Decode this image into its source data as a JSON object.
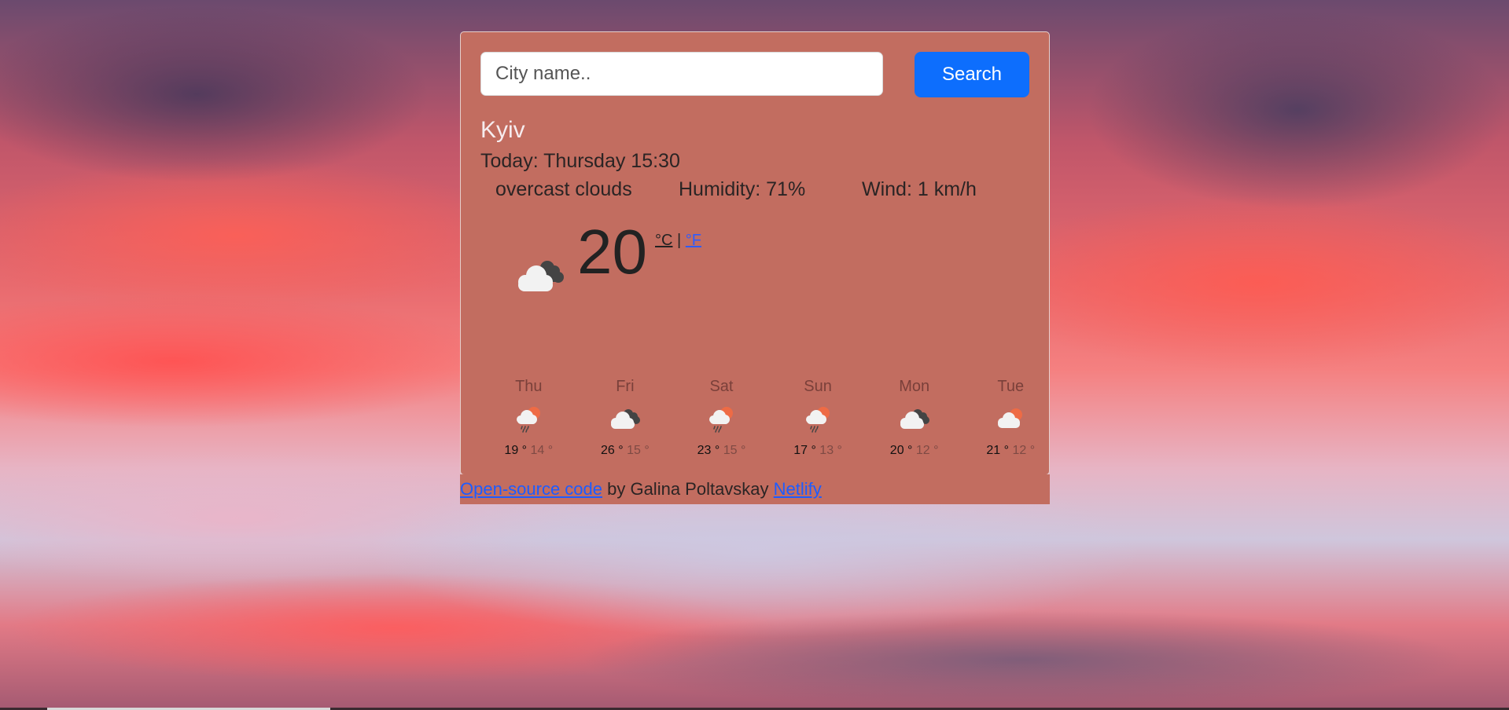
{
  "search": {
    "placeholder": "City name..",
    "value": "",
    "button_label": "Search"
  },
  "current": {
    "city": "Kyiv",
    "today": "Today: Thursday 15:30",
    "description": "overcast clouds",
    "humidity": "Humidity: 71%",
    "wind": "Wind: 1 km/h",
    "temperature": "20",
    "icon": "overcast-clouds-icon",
    "unit_celsius": "°C",
    "unit_separator": "|",
    "unit_fahrenheit": "°F"
  },
  "forecast": [
    {
      "day": "Thu",
      "icon": "rain-sun-icon",
      "max": "19 °",
      "min": "14 °"
    },
    {
      "day": "Fri",
      "icon": "overcast-clouds-icon",
      "max": "26 °",
      "min": "15 °"
    },
    {
      "day": "Sat",
      "icon": "rain-sun-icon",
      "max": "23 °",
      "min": "15 °"
    },
    {
      "day": "Sun",
      "icon": "rain-sun-icon",
      "max": "17 °",
      "min": "13 °"
    },
    {
      "day": "Mon",
      "icon": "overcast-clouds-icon",
      "max": "20 °",
      "min": "12 °"
    },
    {
      "day": "Tue",
      "icon": "sun-cloud-icon",
      "max": "21 °",
      "min": "12 °"
    }
  ],
  "footer": {
    "source_link": "Open-source code",
    "by_text": " by Galina Poltavskay ",
    "host_link": "Netlify"
  },
  "colors": {
    "card_bg": "#c26d60",
    "button_bg": "#0d6efd",
    "link": "#1d5cff",
    "sun": "#ee6b45",
    "cloud_light": "#f2f2f2",
    "cloud_dark": "#444444"
  }
}
